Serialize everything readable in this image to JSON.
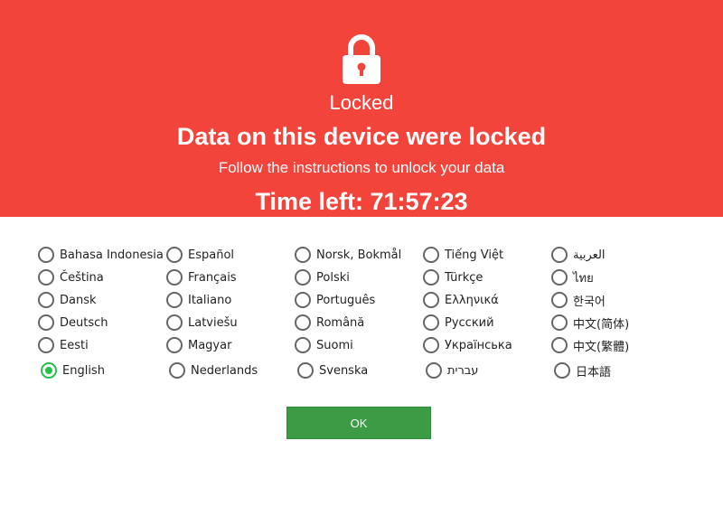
{
  "header": {
    "status": "Locked",
    "title": "Data on this device were locked",
    "subtitle": "Follow the instructions to unlock your data",
    "timer": "Time left: 71:57:23",
    "icon": "lock-icon"
  },
  "colors": {
    "banner": "#f3443b",
    "selected": "#23c14a",
    "ok_button": "#3d9b46"
  },
  "languages": [
    [
      "Bahasa Indonesia",
      "Čeština",
      "Dansk",
      "Deutsch",
      "Eesti",
      "English"
    ],
    [
      "Español",
      "Français",
      "Italiano",
      "Latviešu",
      "Magyar",
      "Nederlands"
    ],
    [
      "Norsk, Bokmål",
      "Polski",
      "Português",
      "Română",
      "Suomi",
      "Svenska"
    ],
    [
      "Tiếng Việt",
      "Türkçe",
      "Ελληνικά",
      "Русский",
      "Українська",
      "עברית"
    ],
    [
      "العربية",
      "ไทย",
      "한국어",
      "中文(简体)",
      "中文(繁體)",
      "日本語"
    ]
  ],
  "selected_language": "English",
  "ok_label": "OK"
}
